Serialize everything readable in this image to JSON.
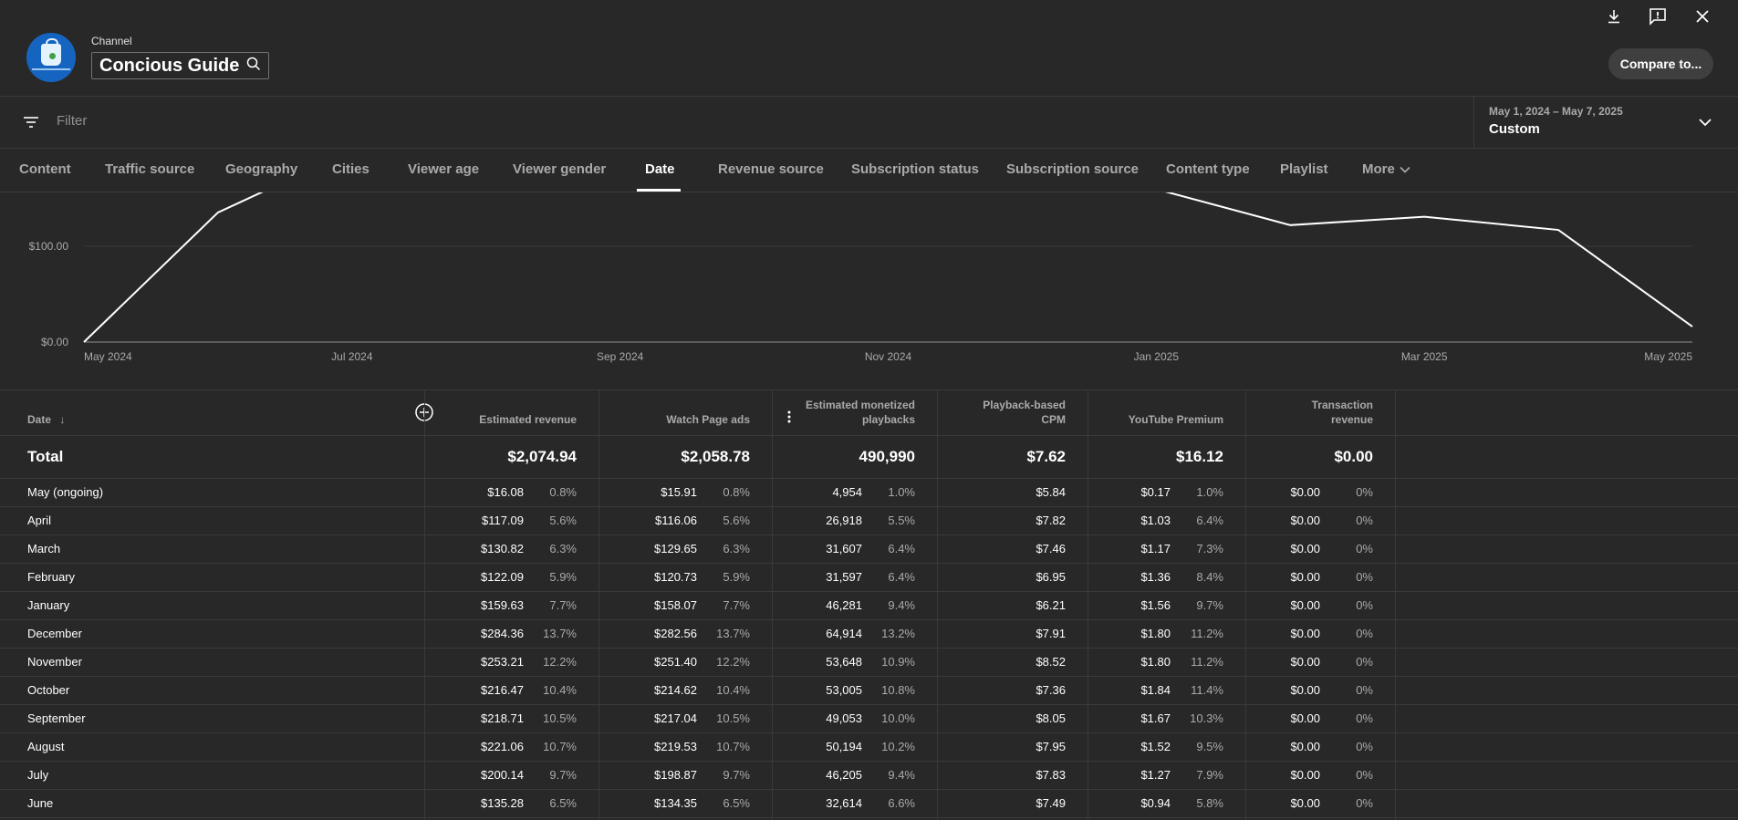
{
  "header": {
    "channel_label": "Channel",
    "channel_name": "Concious Guide",
    "compare_label": "Compare to..."
  },
  "filter": {
    "placeholder": "Filter"
  },
  "date_range": {
    "range": "May 1, 2024 – May 7, 2025",
    "preset": "Custom"
  },
  "tabs": [
    "Content",
    "Traffic source",
    "Geography",
    "Cities",
    "Viewer age",
    "Viewer gender",
    "Date",
    "Revenue source",
    "Subscription status",
    "Subscription source",
    "Content type",
    "Playlist",
    "More"
  ],
  "active_tab": "Date",
  "chart_data": {
    "type": "line",
    "x": [
      "May 2024",
      "Jun 2024",
      "Jul 2024",
      "Aug 2024",
      "Sep 2024",
      "Oct 2024",
      "Nov 2024",
      "Dec 2024",
      "Jan 2025",
      "Feb 2025",
      "Mar 2025",
      "Apr 2025",
      "May 2025"
    ],
    "x_tick_labels": [
      "May 2024",
      "Jul 2024",
      "Sep 2024",
      "Nov 2024",
      "Jan 2025",
      "Mar 2025",
      "May 2025"
    ],
    "y_tick_labels": [
      "$0.00",
      "$100.00"
    ],
    "series": [
      {
        "values": [
          0,
          135.28,
          200.14,
          221.06,
          218.71,
          216.47,
          253.21,
          284.36,
          159.63,
          122.09,
          130.82,
          117.09,
          16.08
        ]
      }
    ],
    "ylim": [
      0,
      158
    ],
    "grid": true,
    "line_color": "#ffffff"
  },
  "table": {
    "columns": [
      {
        "label": "Date",
        "sort": "↓"
      },
      {
        "label": "Estimated revenue"
      },
      {
        "label": "Watch Page ads"
      },
      {
        "label_line1": "Estimated monetized",
        "label_line2": "playbacks"
      },
      {
        "label_line1": "Playback-based",
        "label_line2": "CPM"
      },
      {
        "label": "YouTube Premium"
      },
      {
        "label_line1": "Transaction",
        "label_line2": "revenue"
      }
    ],
    "total": {
      "label": "Total",
      "revenue": "$2,074.94",
      "watch_ads": "$2,058.78",
      "playbacks": "490,990",
      "cpm": "$7.62",
      "premium": "$16.12",
      "transaction": "$0.00"
    },
    "rows": [
      {
        "date": "May (ongoing)",
        "rev": "$16.08",
        "rev_pct": "0.8%",
        "ads": "$15.91",
        "ads_pct": "0.8%",
        "pb": "4,954",
        "pb_pct": "1.0%",
        "cpm": "$5.84",
        "prem": "$0.17",
        "prem_pct": "1.0%",
        "tr": "$0.00",
        "tr_pct": "0%"
      },
      {
        "date": "April",
        "rev": "$117.09",
        "rev_pct": "5.6%",
        "ads": "$116.06",
        "ads_pct": "5.6%",
        "pb": "26,918",
        "pb_pct": "5.5%",
        "cpm": "$7.82",
        "prem": "$1.03",
        "prem_pct": "6.4%",
        "tr": "$0.00",
        "tr_pct": "0%"
      },
      {
        "date": "March",
        "rev": "$130.82",
        "rev_pct": "6.3%",
        "ads": "$129.65",
        "ads_pct": "6.3%",
        "pb": "31,607",
        "pb_pct": "6.4%",
        "cpm": "$7.46",
        "prem": "$1.17",
        "prem_pct": "7.3%",
        "tr": "$0.00",
        "tr_pct": "0%"
      },
      {
        "date": "February",
        "rev": "$122.09",
        "rev_pct": "5.9%",
        "ads": "$120.73",
        "ads_pct": "5.9%",
        "pb": "31,597",
        "pb_pct": "6.4%",
        "cpm": "$6.95",
        "prem": "$1.36",
        "prem_pct": "8.4%",
        "tr": "$0.00",
        "tr_pct": "0%"
      },
      {
        "date": "January",
        "rev": "$159.63",
        "rev_pct": "7.7%",
        "ads": "$158.07",
        "ads_pct": "7.7%",
        "pb": "46,281",
        "pb_pct": "9.4%",
        "cpm": "$6.21",
        "prem": "$1.56",
        "prem_pct": "9.7%",
        "tr": "$0.00",
        "tr_pct": "0%"
      },
      {
        "date": "December",
        "rev": "$284.36",
        "rev_pct": "13.7%",
        "ads": "$282.56",
        "ads_pct": "13.7%",
        "pb": "64,914",
        "pb_pct": "13.2%",
        "cpm": "$7.91",
        "prem": "$1.80",
        "prem_pct": "11.2%",
        "tr": "$0.00",
        "tr_pct": "0%"
      },
      {
        "date": "November",
        "rev": "$253.21",
        "rev_pct": "12.2%",
        "ads": "$251.40",
        "ads_pct": "12.2%",
        "pb": "53,648",
        "pb_pct": "10.9%",
        "cpm": "$8.52",
        "prem": "$1.80",
        "prem_pct": "11.2%",
        "tr": "$0.00",
        "tr_pct": "0%"
      },
      {
        "date": "October",
        "rev": "$216.47",
        "rev_pct": "10.4%",
        "ads": "$214.62",
        "ads_pct": "10.4%",
        "pb": "53,005",
        "pb_pct": "10.8%",
        "cpm": "$7.36",
        "prem": "$1.84",
        "prem_pct": "11.4%",
        "tr": "$0.00",
        "tr_pct": "0%"
      },
      {
        "date": "September",
        "rev": "$218.71",
        "rev_pct": "10.5%",
        "ads": "$217.04",
        "ads_pct": "10.5%",
        "pb": "49,053",
        "pb_pct": "10.0%",
        "cpm": "$8.05",
        "prem": "$1.67",
        "prem_pct": "10.3%",
        "tr": "$0.00",
        "tr_pct": "0%"
      },
      {
        "date": "August",
        "rev": "$221.06",
        "rev_pct": "10.7%",
        "ads": "$219.53",
        "ads_pct": "10.7%",
        "pb": "50,194",
        "pb_pct": "10.2%",
        "cpm": "$7.95",
        "prem": "$1.52",
        "prem_pct": "9.5%",
        "tr": "$0.00",
        "tr_pct": "0%"
      },
      {
        "date": "July",
        "rev": "$200.14",
        "rev_pct": "9.7%",
        "ads": "$198.87",
        "ads_pct": "9.7%",
        "pb": "46,205",
        "pb_pct": "9.4%",
        "cpm": "$7.83",
        "prem": "$1.27",
        "prem_pct": "7.9%",
        "tr": "$0.00",
        "tr_pct": "0%"
      },
      {
        "date": "June",
        "rev": "$135.28",
        "rev_pct": "6.5%",
        "ads": "$134.35",
        "ads_pct": "6.5%",
        "pb": "32,614",
        "pb_pct": "6.6%",
        "cpm": "$7.49",
        "prem": "$0.94",
        "prem_pct": "5.8%",
        "tr": "$0.00",
        "tr_pct": "0%"
      }
    ]
  },
  "icons": {
    "download": "download-icon",
    "feedback": "feedback-icon",
    "close": "close-icon",
    "search": "search-icon",
    "filter": "filter-icon",
    "chevron": "chevron-down-icon",
    "add_column": "add-column-icon",
    "column_menu": "more-vert-icon",
    "sort": "sort-down-icon"
  }
}
